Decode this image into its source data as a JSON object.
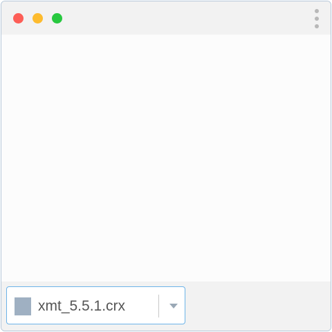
{
  "window": {
    "controls": [
      {
        "name": "close",
        "color": "#fd5e57"
      },
      {
        "name": "minimize",
        "color": "#fdbb2e"
      },
      {
        "name": "zoom",
        "color": "#27c83f"
      }
    ],
    "menu_icon": "more-vertical-icon"
  },
  "download_shelf": {
    "items": [
      {
        "file_name": "xmt_5.5.1.crx",
        "file_icon": "file-icon",
        "menu_icon": "chevron-down-icon",
        "accent_color": "#6bb3e8"
      }
    ]
  }
}
